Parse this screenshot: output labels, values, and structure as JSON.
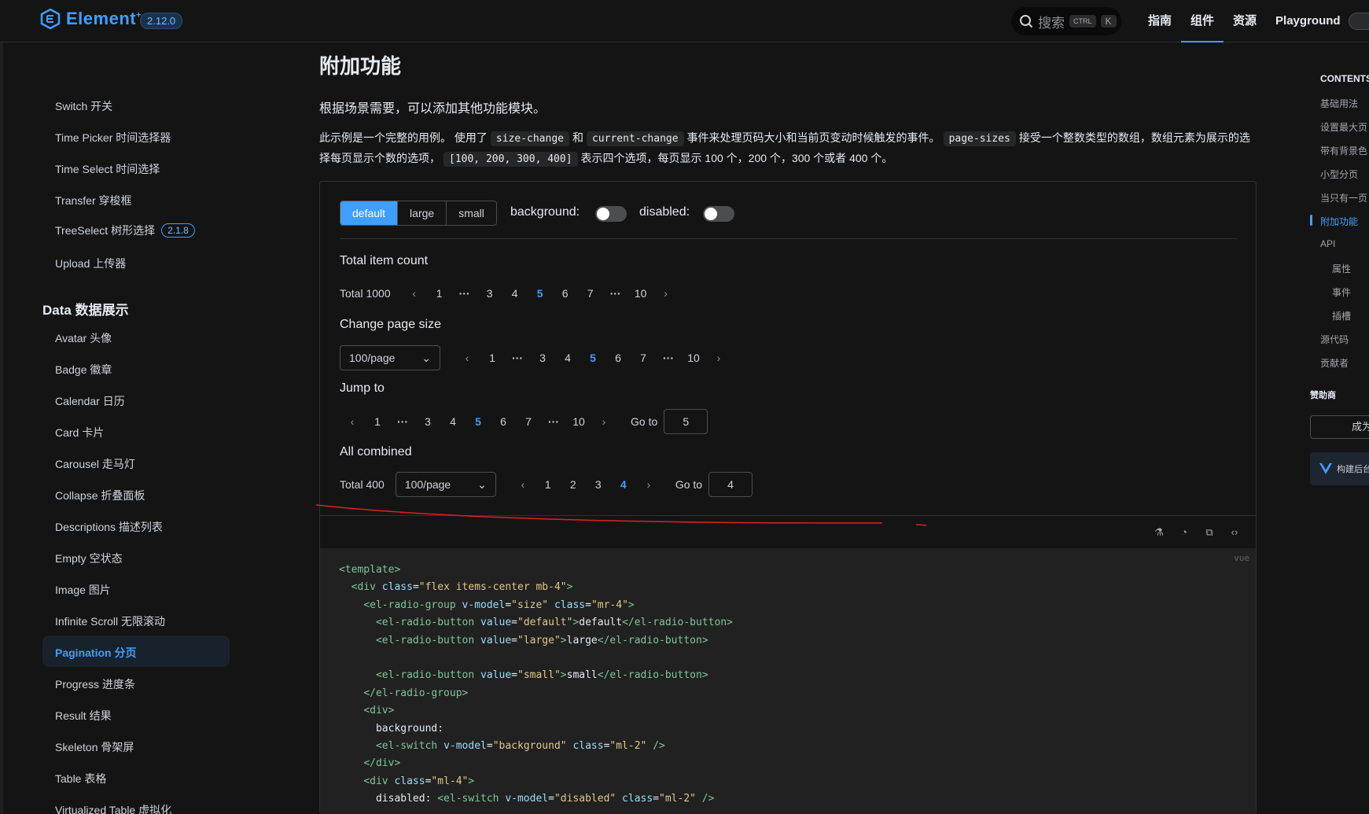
{
  "nav": {
    "logo_text": "Element",
    "logo_plus": "+",
    "version": "2.12.0",
    "search_placeholder": "搜索",
    "kbd_ctrl": "CTRL",
    "kbd_k": "K",
    "links": [
      "指南",
      "组件",
      "资源",
      "Playground"
    ],
    "active_link": "组件"
  },
  "sidebar": {
    "items_top": [
      {
        "label": "Switch 开关"
      },
      {
        "label": "Time Picker 时间选择器"
      },
      {
        "label": "Time Select 时间选择"
      },
      {
        "label": "Transfer 穿梭框"
      },
      {
        "label": "TreeSelect 树形选择",
        "badge": "2.1.8"
      },
      {
        "label": "Upload 上传器"
      }
    ],
    "group_title": "Data 数据展示",
    "items_data": [
      {
        "label": "Avatar 头像"
      },
      {
        "label": "Badge 徽章"
      },
      {
        "label": "Calendar 日历"
      },
      {
        "label": "Card 卡片"
      },
      {
        "label": "Carousel 走马灯"
      },
      {
        "label": "Collapse 折叠面板"
      },
      {
        "label": "Descriptions 描述列表"
      },
      {
        "label": "Empty 空状态"
      },
      {
        "label": "Image 图片"
      },
      {
        "label": "Infinite Scroll 无限滚动"
      },
      {
        "label": "Pagination 分页"
      },
      {
        "label": "Progress 进度条"
      },
      {
        "label": "Result 结果"
      },
      {
        "label": "Skeleton 骨架屏"
      },
      {
        "label": "Table 表格"
      },
      {
        "label": "Virtualized Table 虚拟化"
      }
    ],
    "active_item": "Pagination 分页"
  },
  "main": {
    "title": "附加功能",
    "desc": "根据场景需要，可以添加其他功能模块。",
    "para_1": "此示例是一个完整的用例。 使用了",
    "code_1": "size-change",
    "para_2": "和",
    "code_2": "current-change",
    "para_3": "事件来处理页码大小和当前页变动时候触发的事件。",
    "code_3": "page-sizes",
    "para_4": "接受一个整数类型的数组，数组元素为展示的选择每页显示个数的选项，",
    "code_4": "[100, 200, 300, 400]",
    "para_5": "表示四个选项，每页显示 100 个，200 个，300 个或者 400 个。"
  },
  "demo": {
    "radio_options": [
      "default",
      "large",
      "small"
    ],
    "radio_selected": "default",
    "background_label": "background:",
    "disabled_label": "disabled:",
    "background_on": false,
    "disabled_on": false,
    "sections": {
      "total": "Total item count",
      "size": "Change page size",
      "jump": "Jump to",
      "all": "All combined"
    },
    "pager1": {
      "total": "Total 1000",
      "pages": [
        "1",
        "···",
        "3",
        "4",
        "5",
        "6",
        "7",
        "···",
        "10"
      ],
      "current": "5"
    },
    "pager2": {
      "select": "100/page",
      "pages": [
        "1",
        "···",
        "3",
        "4",
        "5",
        "6",
        "7",
        "···",
        "10"
      ],
      "current": "5"
    },
    "pager3": {
      "pages": [
        "1",
        "···",
        "3",
        "4",
        "5",
        "6",
        "7",
        "···",
        "10"
      ],
      "current": "5",
      "goto_label": "Go to",
      "goto_value": "5"
    },
    "pager4": {
      "total": "Total 400",
      "select": "100/page",
      "pages": [
        "1",
        "2",
        "3",
        "4"
      ],
      "current": "4",
      "goto_label": "Go to",
      "goto_value": "4"
    },
    "prev_glyph": "‹",
    "next_glyph": "›",
    "chevron": "⌄",
    "lang": "vue"
  },
  "code": [
    [
      [
        "tg",
        "<template>"
      ]
    ],
    [
      [
        "p",
        "  "
      ],
      [
        "tg",
        "<div "
      ],
      [
        "at",
        "class"
      ],
      [
        "p",
        "="
      ],
      [
        "st",
        "\"flex items-center mb-4\""
      ],
      [
        "tg",
        ">"
      ]
    ],
    [
      [
        "p",
        "    "
      ],
      [
        "tg",
        "<el-radio-group "
      ],
      [
        "at",
        "v-model"
      ],
      [
        "p",
        "="
      ],
      [
        "st",
        "\"size\" "
      ],
      [
        "at",
        "class"
      ],
      [
        "p",
        "="
      ],
      [
        "st",
        "\"mr-4\""
      ],
      [
        "tg",
        ">"
      ]
    ],
    [
      [
        "p",
        "      "
      ],
      [
        "tg",
        "<el-radio-button "
      ],
      [
        "at",
        "value"
      ],
      [
        "p",
        "="
      ],
      [
        "st",
        "\"default\""
      ],
      [
        "tg",
        ">"
      ],
      [
        "p",
        "default"
      ],
      [
        "tg",
        "</el-radio-button>"
      ]
    ],
    [
      [
        "p",
        "      "
      ],
      [
        "tg",
        "<el-radio-button "
      ],
      [
        "at",
        "value"
      ],
      [
        "p",
        "="
      ],
      [
        "st",
        "\"large\""
      ],
      [
        "tg",
        ">"
      ],
      [
        "p",
        "large"
      ],
      [
        "tg",
        "</el-radio-button>"
      ]
    ],
    [],
    [
      [
        "p",
        "      "
      ],
      [
        "tg",
        "<el-radio-button "
      ],
      [
        "at",
        "value"
      ],
      [
        "p",
        "="
      ],
      [
        "st",
        "\"small\""
      ],
      [
        "tg",
        ">"
      ],
      [
        "p",
        "small"
      ],
      [
        "tg",
        "</el-radio-button>"
      ]
    ],
    [
      [
        "p",
        "    "
      ],
      [
        "tg",
        "</el-radio-group>"
      ]
    ],
    [
      [
        "p",
        "    "
      ],
      [
        "tg",
        "<div>"
      ]
    ],
    [
      [
        "p",
        "      background:"
      ]
    ],
    [
      [
        "p",
        "      "
      ],
      [
        "tg",
        "<el-switch "
      ],
      [
        "at",
        "v-model"
      ],
      [
        "p",
        "="
      ],
      [
        "st",
        "\"background\" "
      ],
      [
        "at",
        "class"
      ],
      [
        "p",
        "="
      ],
      [
        "st",
        "\"ml-2\""
      ],
      [
        "tg",
        " />"
      ]
    ],
    [
      [
        "p",
        "    "
      ],
      [
        "tg",
        "</div>"
      ]
    ],
    [
      [
        "p",
        "    "
      ],
      [
        "tg",
        "<div "
      ],
      [
        "at",
        "class"
      ],
      [
        "p",
        "="
      ],
      [
        "st",
        "\"ml-4\""
      ],
      [
        "tg",
        ">"
      ]
    ],
    [
      [
        "p",
        "      disabled: "
      ],
      [
        "tg",
        "<el-switch "
      ],
      [
        "at",
        "v-model"
      ],
      [
        "p",
        "="
      ],
      [
        "st",
        "\"disabled\" "
      ],
      [
        "at",
        "class"
      ],
      [
        "p",
        "="
      ],
      [
        "st",
        "\"ml-2\""
      ],
      [
        "tg",
        " />"
      ]
    ]
  ],
  "toc": {
    "head": "CONTENTS",
    "items": [
      "基础用法",
      "设置最大页",
      "带有背景色",
      "小型分页",
      "当只有一页",
      "附加功能",
      "API",
      "属性",
      "事件",
      "插槽",
      "源代码",
      "贡献者"
    ],
    "active": "附加功能",
    "sponsor_head": "赞助商",
    "sponsor_btn": "成为",
    "sponsor_card": "构建后台"
  },
  "colors": {
    "accent": "#409eff",
    "bg": "#141414",
    "code_bg": "#212121",
    "annotation": "#e02020"
  }
}
